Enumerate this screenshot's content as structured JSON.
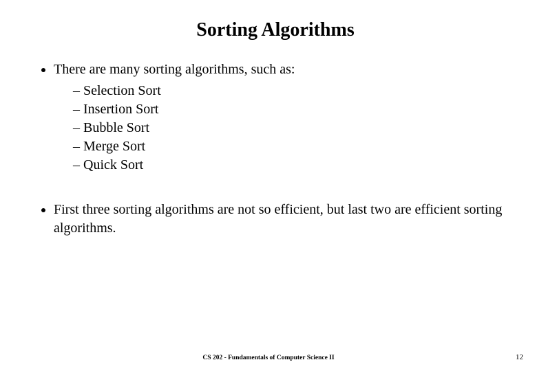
{
  "title": "Sorting Algorithms",
  "bullets": {
    "intro": "There are many sorting algorithms, such as:",
    "items": [
      "Selection Sort",
      "Insertion Sort",
      "Bubble Sort",
      "Merge Sort",
      "Quick Sort"
    ],
    "note": "First three sorting algorithms are not so efficient, but last two are efficient sorting algorithms."
  },
  "footer": {
    "course": "CS 202 - Fundamentals of Computer Science II",
    "page": "12"
  }
}
